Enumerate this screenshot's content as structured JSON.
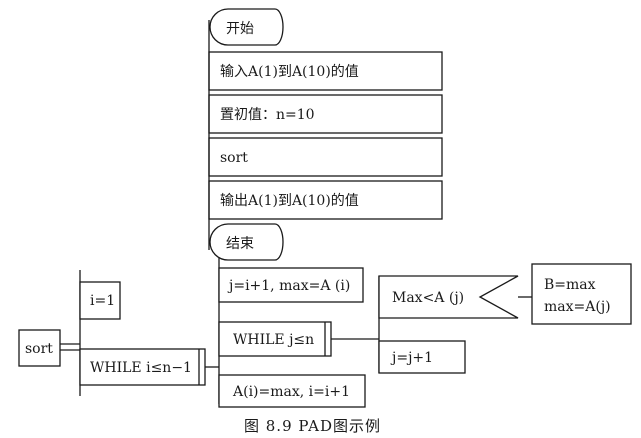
{
  "top_flow": {
    "start": "开始",
    "steps": [
      "输入A(1)到A(10)的值",
      "置初值：n=10",
      "sort",
      "输出A(1)到A(10)的值"
    ],
    "end": "结束"
  },
  "pad": {
    "root": "sort",
    "level1": [
      "i=1",
      "WHILE i≤n−1"
    ],
    "level2": [
      "j=i+1, max=A (i)",
      "WHILE j≤n",
      "A(i)=max, i=i+1"
    ],
    "level3": [
      "Max<A (j)",
      "j=j+1"
    ],
    "branch": [
      "B=max",
      "max=A(j)"
    ]
  },
  "caption": "图 8.9   PAD图示例"
}
